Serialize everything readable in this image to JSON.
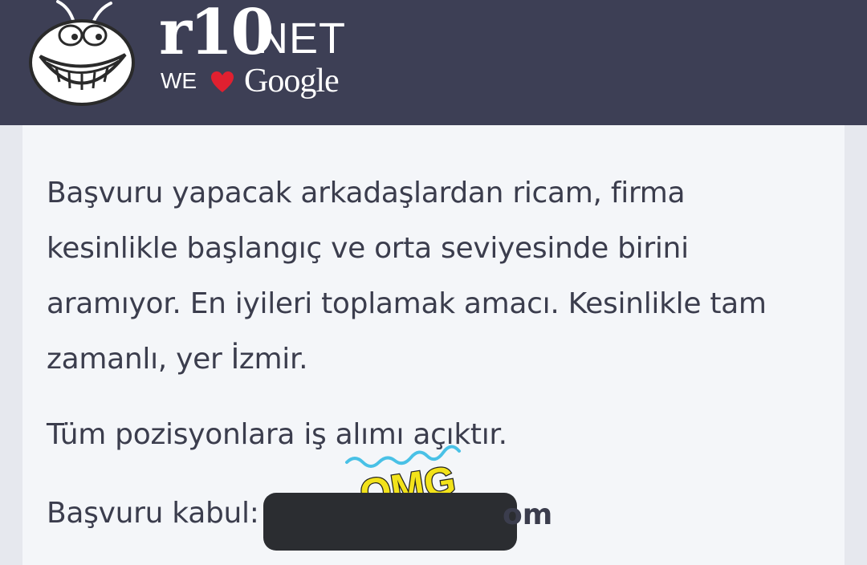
{
  "header": {
    "brand_main": "r10",
    "brand_suffix": "NET",
    "tagline_prefix": "WE",
    "tagline_icon": "heart-icon",
    "tagline_brand": "Google",
    "background": "#3d3f55"
  },
  "post": {
    "paragraph_1": "Başvuru yapacak arkadaşlardan ricam, firma kesinlikle başlangıç ve orta seviyesinde birini aramıyor. En iyileri toplamak amacı. Kesinlikle tam zamanlı, yer İzmir.",
    "sticker_text": "OMG",
    "paragraph_2": "Tüm pozisyonlara iş alımı açıktır.",
    "application_label": "Başvuru kabul:",
    "email_visible_end": "om",
    "text_color": "#3b3d4d",
    "card_background": "#f4f6f9"
  }
}
